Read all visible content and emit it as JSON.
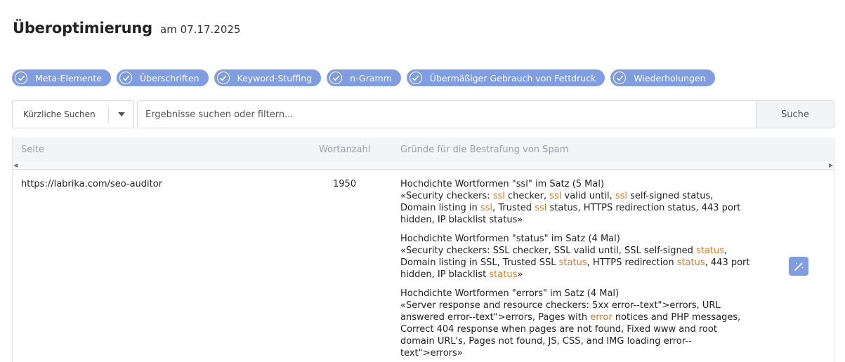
{
  "header": {
    "title": "Überoptimierung",
    "date": "am 07.17.2025"
  },
  "filters": [
    {
      "label": "Meta-Elemente",
      "checked": true
    },
    {
      "label": "Überschriften",
      "checked": true
    },
    {
      "label": "Keyword-Stuffing",
      "checked": true
    },
    {
      "label": "n-Gramm",
      "checked": true
    },
    {
      "label": "Übermäßiger Gebrauch von Fettdruck",
      "checked": true
    },
    {
      "label": "Wiederholungen",
      "checked": true
    }
  ],
  "search": {
    "recent_label": "Kürzliche Suchen",
    "placeholder": "Ergebnisse suchen oder filtern...",
    "button": "Suche"
  },
  "table": {
    "columns": [
      "Seite",
      "Wortanzahl",
      "Gründe für die Bestrafung von Spam"
    ],
    "rows": [
      {
        "url": "https://labrika.com/seo-auditor",
        "word_count": "1950",
        "reasons": [
          {
            "heading": "Hochdichte Wortformen \"ssl\" im Satz (5 Mal)",
            "parts": [
              {
                "t": "«Security checkers: "
              },
              {
                "t": "ssl",
                "hl": true
              },
              {
                "t": " checker, "
              },
              {
                "t": "ssl",
                "hl": true
              },
              {
                "t": " valid until, "
              },
              {
                "t": "ssl",
                "hl": true
              },
              {
                "t": " self-signed status, Domain listing in "
              },
              {
                "t": "ssl",
                "hl": true
              },
              {
                "t": ", Trusted "
              },
              {
                "t": "ssl",
                "hl": true
              },
              {
                "t": " status, HTTPS redirection status, 443 port hidden, IP blacklist status»"
              }
            ]
          },
          {
            "heading": "Hochdichte Wortformen \"status\" im Satz (4 Mal)",
            "parts": [
              {
                "t": "«Security checkers: SSL checker, SSL valid until, SSL self-signed "
              },
              {
                "t": "status",
                "hl": true
              },
              {
                "t": ", Domain listing in SSL, Trusted SSL "
              },
              {
                "t": "status",
                "hl": true
              },
              {
                "t": ", HTTPS redirection "
              },
              {
                "t": "status",
                "hl": true
              },
              {
                "t": ", 443 port hidden, IP blacklist "
              },
              {
                "t": "status",
                "hl": true
              },
              {
                "t": "»"
              }
            ]
          },
          {
            "heading": "Hochdichte Wortformen \"errors\" im Satz (4 Mal)",
            "parts": [
              {
                "t": "«Server response and resource checkers: 5xx error--text\">errors, URL answered error--text\">errors, Pages with "
              },
              {
                "t": "error",
                "hl": true
              },
              {
                "t": " notices and PHP messages, Correct 404 response when pages are not found, Fixed www and root domain URL's, Pages not found, JS, CSS, and IMG loading error--text\">errors»"
              }
            ]
          }
        ]
      }
    ]
  },
  "colors": {
    "accent": "#7f9de0",
    "highlight": "#d67a24"
  },
  "icons": {
    "chip": "check-icon",
    "dropdown": "chevron-down-icon",
    "action": "magic-wand-icon",
    "scroll_left": "arrow-left-icon",
    "scroll_right": "arrow-right-icon"
  }
}
